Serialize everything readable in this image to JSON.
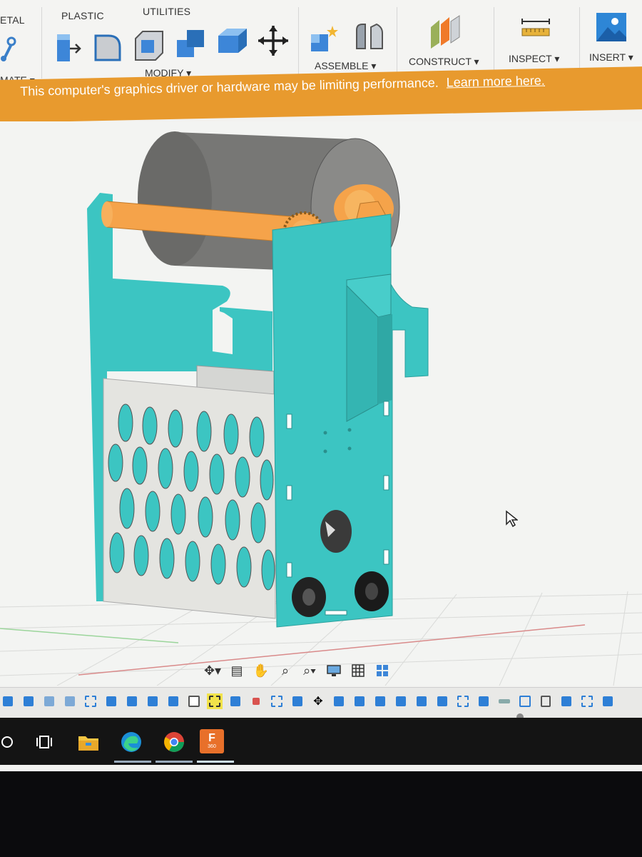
{
  "toolbar": {
    "tabs": [
      "ETAL",
      "PLASTIC",
      "UTILITIES"
    ],
    "groups": {
      "mate": "MATE ▾",
      "modify": "MODIFY ▾",
      "assemble": "ASSEMBLE ▾",
      "construct": "CONSTRUCT ▾",
      "inspect": "INSPECT ▾",
      "insert": "INSERT ▾"
    }
  },
  "banner": {
    "message": "This computer's graphics driver or hardware may be limiting performance.",
    "link": "Learn more here."
  },
  "colors": {
    "banner": "#e89a2e",
    "panel_teal": "#3cc5c2",
    "roller_gray": "#7a7a78",
    "orange_part": "#f5a34a",
    "grate": "#e4e4e0",
    "timeline_blue": "#2e7fd6"
  },
  "navbar_icons": [
    "orbit-icon",
    "look-at-icon",
    "pan-icon",
    "zoom-icon",
    "fit-icon",
    "display-settings-icon",
    "grid-icon",
    "viewports-icon"
  ],
  "taskbar_icons": [
    "search-icon",
    "task-view-icon",
    "file-explorer-icon",
    "edge-icon",
    "chrome-icon",
    "fusion360-icon"
  ],
  "taskbar": {
    "fusion_label": "F",
    "fusion_sub": "360"
  }
}
